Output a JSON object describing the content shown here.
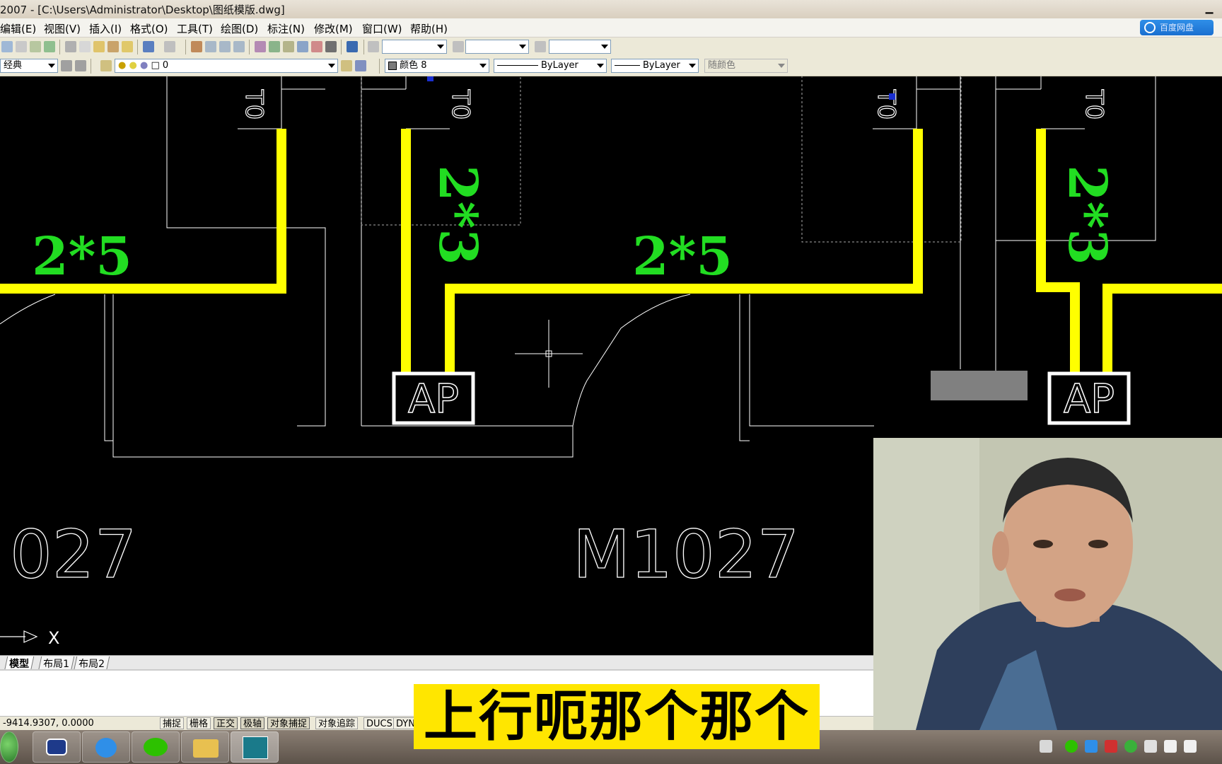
{
  "window": {
    "title": "2007 - [C:\\Users\\Administrator\\Desktop\\图纸模版.dwg]",
    "minimize_glyph": "▁"
  },
  "menubar": {
    "items": [
      "编辑(E)",
      "视图(V)",
      "插入(I)",
      "格式(O)",
      "工具(T)",
      "绘图(D)",
      "标注(N)",
      "修改(M)",
      "窗口(W)",
      "帮助(H)"
    ],
    "cloud_button_label": "百度网盘"
  },
  "toolbar2": {
    "style_combo": "经典",
    "layer_combo": "0",
    "color_combo": "颜色 8",
    "linetype_combo": "ByLayer",
    "lineweight_combo": "ByLayer",
    "plotstyle_combo": "随颜色"
  },
  "drawing": {
    "labels": {
      "cable_left_horizontal": "2*5",
      "cable_mid_vertical": "2*3",
      "cable_mid_horizontal": "2*5",
      "cable_right_vertical": "2*3",
      "door_left": "027",
      "door_mid": "M1027",
      "ap_left": "AP",
      "ap_right": "AP",
      "axis_x": "X",
      "tag_1": "T0",
      "tag_2": "T0",
      "tag_3": "T0",
      "tag_4": "T0"
    },
    "colors": {
      "cable": "#ffff00",
      "cable_label": "#22dd22",
      "geometry": "#ffffff",
      "background": "#000000",
      "grip": "#1a2fd0"
    }
  },
  "tabs": [
    "模型",
    "布局1",
    "布局2"
  ],
  "statusbar": {
    "coords": "-9414.9307, 0.0000",
    "buttons": [
      "捕捉",
      "栅格",
      "正交",
      "极轴",
      "对象捕捉",
      "对象追踪",
      "DUCS",
      "DYN"
    ]
  },
  "subtitle": "上行呃那个那个",
  "taskbar": {
    "apps": [
      "start",
      "video-app",
      "cloud-app",
      "wechat",
      "file-explorer",
      "autocad"
    ]
  }
}
